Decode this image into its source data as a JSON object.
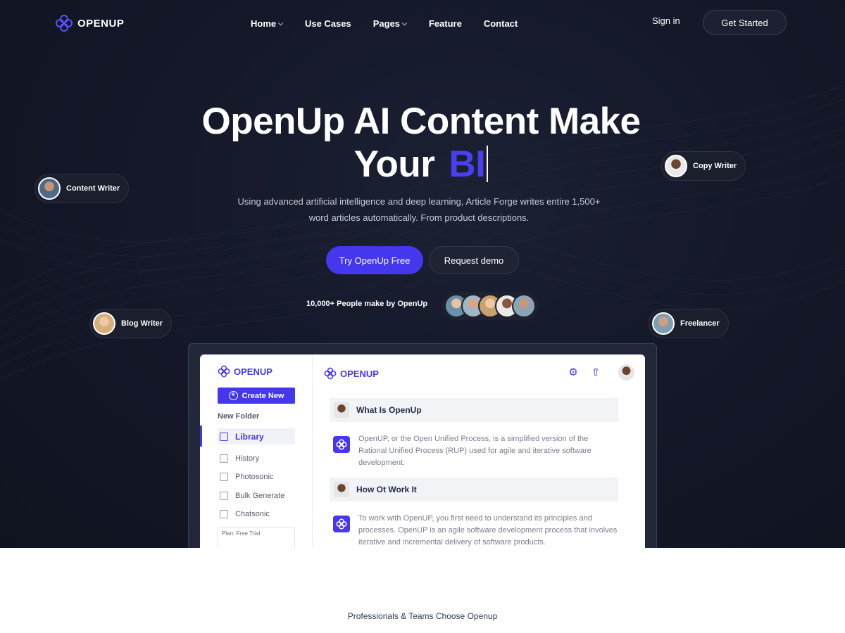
{
  "brand": {
    "name": "OPENUP"
  },
  "nav": {
    "items": [
      {
        "label": "Home",
        "has_dropdown": true
      },
      {
        "label": "Use Cases",
        "has_dropdown": false
      },
      {
        "label": "Pages",
        "has_dropdown": true
      },
      {
        "label": "Feature",
        "has_dropdown": false
      },
      {
        "label": "Contact",
        "has_dropdown": false
      }
    ],
    "sign_in": "Sign in",
    "get_started": "Get Started"
  },
  "hero": {
    "title_line1": "OpenUp AI Content Make",
    "title_line2": "Your",
    "title_typing": "BI",
    "subtitle": "Using advanced artificial intelligence and deep learning, Article Forge writes entire 1,500+ word articles automatically. From product descriptions.",
    "cta_primary": "Try OpenUp Free",
    "cta_secondary": "Request demo",
    "social_proof": "10,000+ People make by OpenUp"
  },
  "floating_tags": {
    "content_writer": "Content Writer",
    "copy_writer": "Copy Writer",
    "blog_writer": "Blog Writer",
    "freelancer": "Freelancer"
  },
  "app_preview": {
    "sidebar_logo": "OPENUP",
    "create_new": "Create New",
    "new_folder": "New Folder",
    "items": {
      "library": "Library",
      "history": "History",
      "photosonic": "Photosonic",
      "bulk_generate": "Bulk Generate",
      "chatsonic": "Chatsonic"
    },
    "plan_label": "Plan: Free Trial",
    "main_logo": "OPENUP",
    "q1": "What Is OpenUp",
    "a1": "OpenUP, or the Open Unified Process, is a simplified version of the Rational Unified Process (RUP) used for agile and iterative software development.",
    "q2": "How Ot Work It",
    "a2": "To work with OpenUP, you first need to understand its principles and processes. OpenUP is an agile software development process that involves iterative and incremental delivery of software products."
  },
  "trust": {
    "text": "Professionals & Teams Choose Openup"
  },
  "colors": {
    "accent": "#4437ee",
    "hero_bg": "#141829"
  }
}
